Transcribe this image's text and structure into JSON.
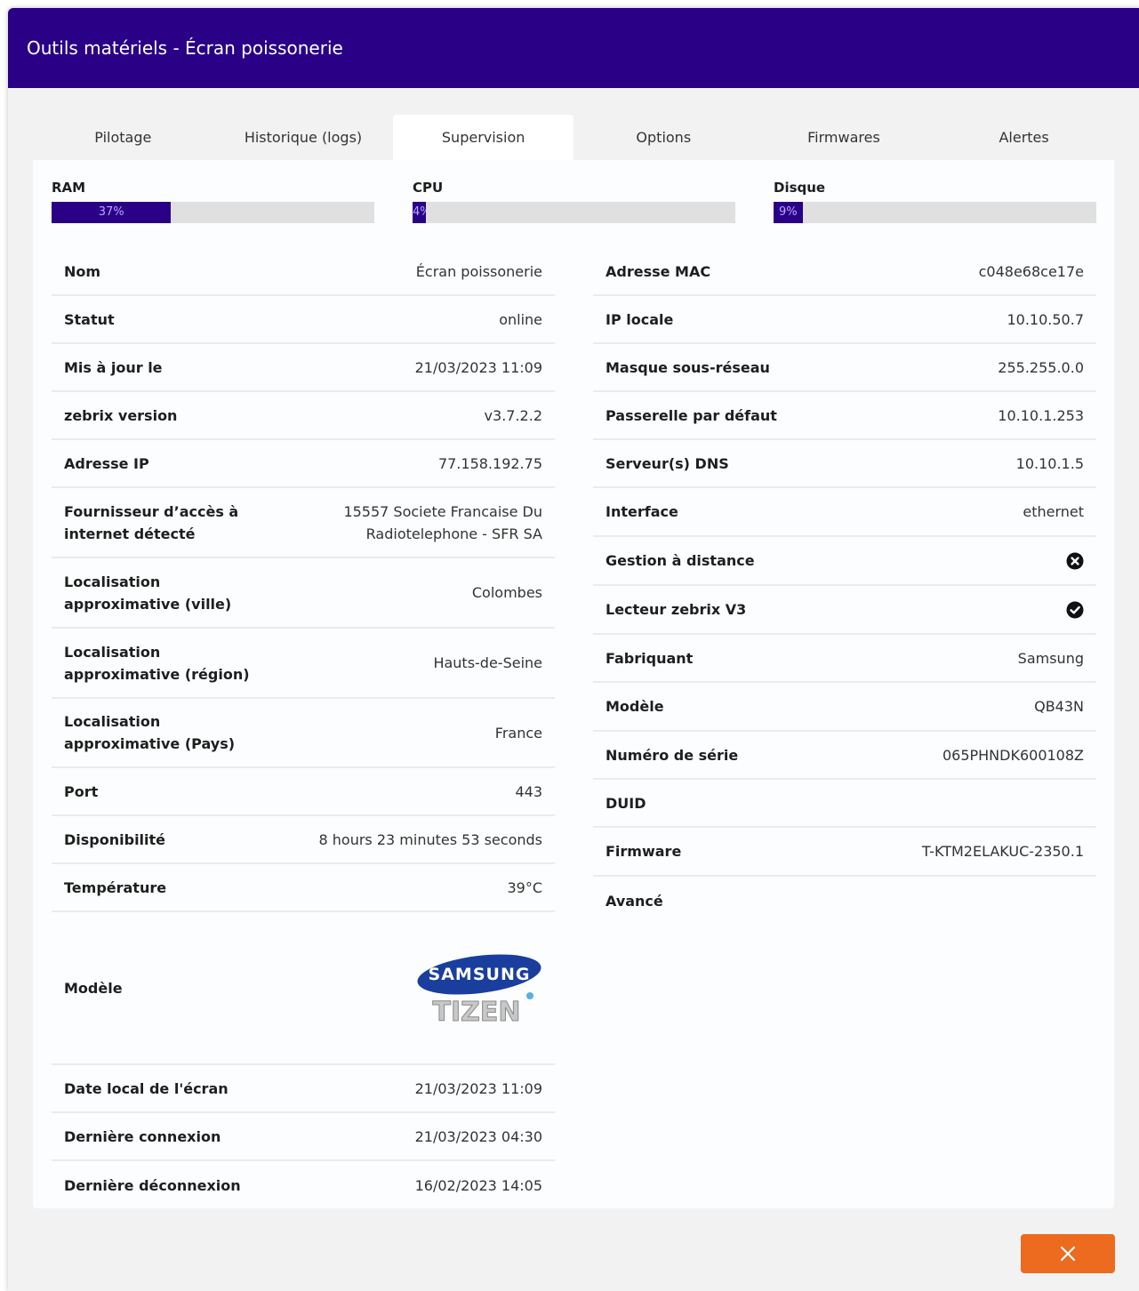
{
  "window": {
    "title": "Outils matériels - Écran poissonerie"
  },
  "tabs": [
    "Pilotage",
    "Historique (logs)",
    "Supervision",
    "Options",
    "Firmwares",
    "Alertes"
  ],
  "active_tab": "Supervision",
  "meters": {
    "ram": {
      "label": "RAM",
      "text": "37%",
      "percent": 37
    },
    "cpu": {
      "label": "CPU",
      "text": "4%",
      "percent": 4
    },
    "disk": {
      "label": "Disque",
      "text": "9%",
      "percent": 9
    }
  },
  "left": {
    "nom": {
      "k": "Nom",
      "v": "Écran poissonerie"
    },
    "statut": {
      "k": "Statut",
      "v": "online"
    },
    "maj": {
      "k": "Mis à jour le",
      "v": "21/03/2023 11:09"
    },
    "version": {
      "k": "zebrix version",
      "v": "v3.7.2.2"
    },
    "ip": {
      "k": "Adresse IP",
      "v": "77.158.192.75"
    },
    "fai": {
      "k1": "Fournisseur d’accès à",
      "k2": "internet détecté",
      "v1": "15557 Societe Francaise Du",
      "v2": "Radiotelephone - SFR SA"
    },
    "ville": {
      "k1": "Localisation",
      "k2": "approximative (ville)",
      "v": "Colombes"
    },
    "region": {
      "k1": "Localisation",
      "k2": "approximative (région)",
      "v": "Hauts-de-Seine"
    },
    "pays": {
      "k1": "Localisation",
      "k2": "approximative (Pays)",
      "v": "France"
    },
    "port": {
      "k": "Port",
      "v": "443"
    },
    "dispo": {
      "k": "Disponibilité",
      "v": "8 hours 23 minutes 53 seconds"
    },
    "temp": {
      "k": "Température",
      "v": "39°C"
    },
    "modele": {
      "k": "Modèle",
      "logo_top": "SAMSUNG",
      "logo_bottom": "TIZEN"
    },
    "date_locale": {
      "k": "Date local de l'écran",
      "v": "21/03/2023 11:09"
    },
    "derniere_connexion": {
      "k": "Dernière connexion",
      "v": "21/03/2023 04:30"
    },
    "derniere_deconnexion": {
      "k": "Dernière déconnexion",
      "v": "16/02/2023 14:05"
    }
  },
  "right": {
    "mac": {
      "k": "Adresse MAC",
      "v": "c048e68ce17e"
    },
    "ip_locale": {
      "k": "IP locale",
      "v": "10.10.50.7"
    },
    "masque": {
      "k": "Masque sous-réseau",
      "v": "255.255.0.0"
    },
    "passerelle": {
      "k": "Passerelle par défaut",
      "v": "10.10.1.253"
    },
    "dns": {
      "k": "Serveur(s) DNS",
      "v": "10.10.1.5"
    },
    "interface": {
      "k": "Interface",
      "v": "ethernet"
    },
    "gestion": {
      "k": "Gestion à distance",
      "icon": "x-circle-icon",
      "enabled": false
    },
    "lecteur": {
      "k": "Lecteur zebrix V3",
      "icon": "check-circle-icon",
      "enabled": true
    },
    "fabriquant": {
      "k": "Fabriquant",
      "v": "Samsung"
    },
    "modele": {
      "k": "Modèle",
      "v": "QB43N"
    },
    "serie": {
      "k": "Numéro de série",
      "v": "065PHNDK600108Z"
    },
    "duid": {
      "k": "DUID",
      "v": ""
    },
    "firmware": {
      "k": "Firmware",
      "v": "T-KTM2ELAKUC-2350.1"
    },
    "avance": {
      "k": "Avancé",
      "v": ""
    }
  },
  "footer": {
    "close_icon": "close-icon"
  },
  "colors": {
    "header": "#2a0087",
    "accent": "#2a0087",
    "close_button": "#ec6b1e"
  }
}
